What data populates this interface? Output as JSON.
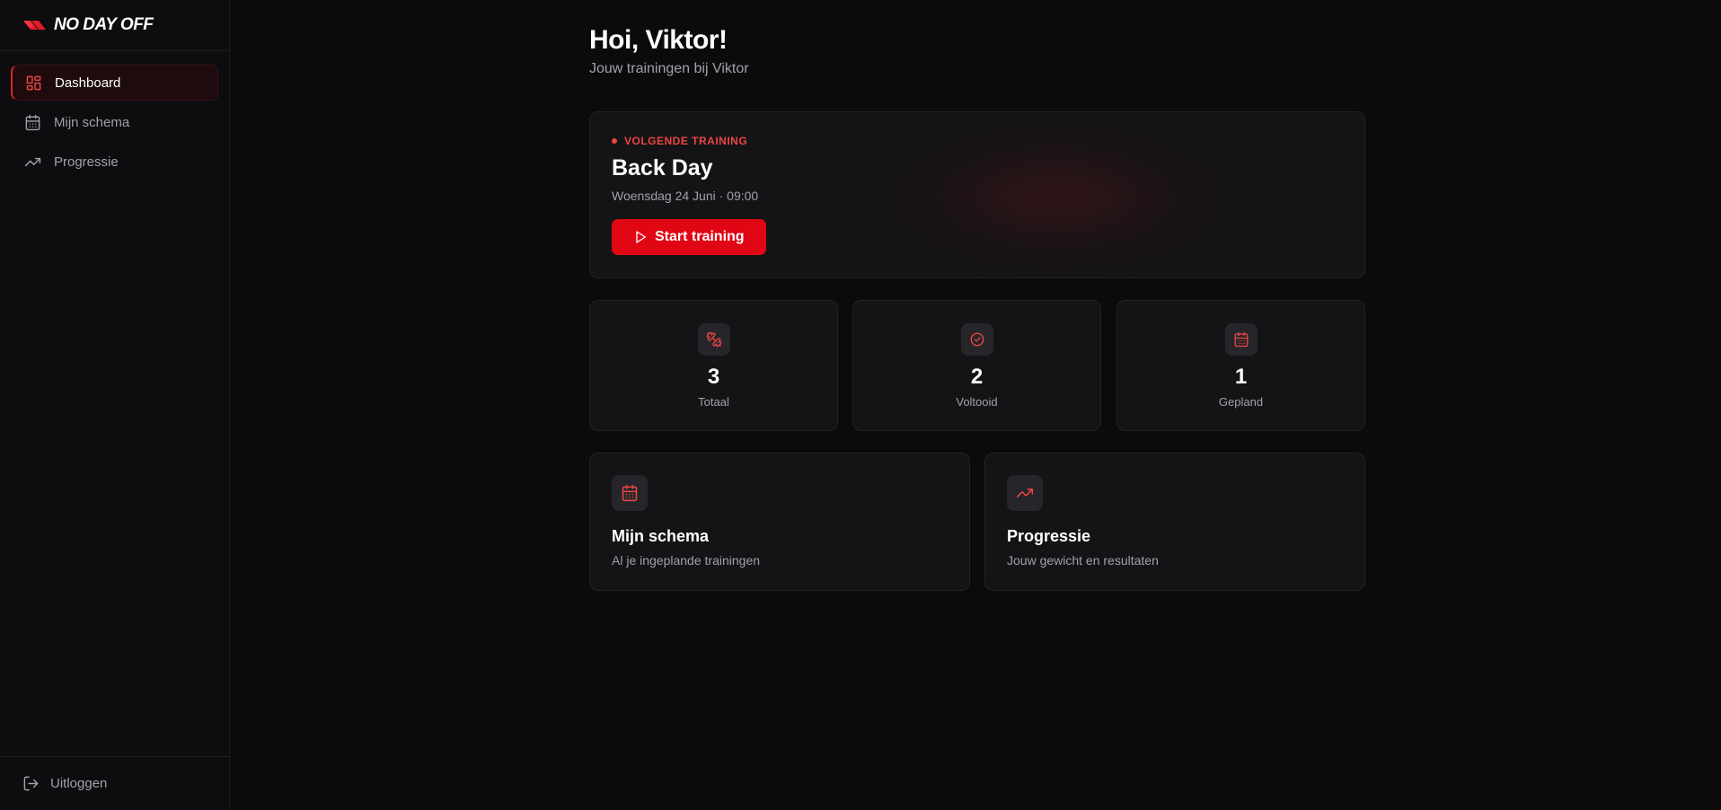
{
  "brand": {
    "name": "NO DAY OFF"
  },
  "sidebar": {
    "items": [
      {
        "label": "Dashboard",
        "icon": "dashboard-icon",
        "active": true
      },
      {
        "label": "Mijn schema",
        "icon": "calendar-icon",
        "active": false
      },
      {
        "label": "Progressie",
        "icon": "trending-up-icon",
        "active": false
      }
    ],
    "logout_label": "Uitloggen"
  },
  "header": {
    "greeting": "Hoi, Viktor!",
    "subtitle": "Jouw trainingen bij Viktor"
  },
  "next_training": {
    "tag": "VOLGENDE TRAINING",
    "title": "Back Day",
    "datetime": "Woensdag 24 Juni · 09:00",
    "button_label": "Start training"
  },
  "stats": [
    {
      "value": "3",
      "label": "Totaal",
      "icon": "dumbbell-icon"
    },
    {
      "value": "2",
      "label": "Voltooid",
      "icon": "check-circle-icon"
    },
    {
      "value": "1",
      "label": "Gepland",
      "icon": "calendar-icon"
    }
  ],
  "cards": [
    {
      "title": "Mijn schema",
      "description": "Al je ingeplande trainingen",
      "icon": "calendar-icon"
    },
    {
      "title": "Progressie",
      "description": "Jouw gewicht en resultaten",
      "icon": "trending-up-icon"
    }
  ],
  "colors": {
    "accent": "#e10613",
    "accent_text": "#ef4444",
    "background": "#0b0b0c",
    "card": "#141416"
  }
}
